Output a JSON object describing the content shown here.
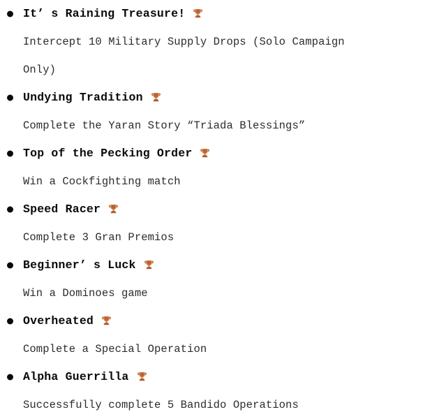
{
  "page": {
    "background_color": "#ffffff",
    "title_color": "#0a0a0a",
    "description_color": "#2c2c2c",
    "bullet_color": "#0b0b0b",
    "trophy_color": "#c87941"
  },
  "achievements": [
    {
      "name": "It’ s Raining Treasure!",
      "icon": "trophy-icon",
      "description_lines": [
        "Intercept 10 Military Supply Drops (Solo Campaign",
        "Only)"
      ]
    },
    {
      "name": "Undying Tradition",
      "icon": "trophy-icon",
      "description_lines": [
        "Complete the Yaran Story “Triada Blessings”"
      ]
    },
    {
      "name": "Top of the Pecking Order",
      "icon": "trophy-icon",
      "description_lines": [
        "Win a Cockfighting match"
      ]
    },
    {
      "name": "Speed Racer",
      "icon": "trophy-icon",
      "description_lines": [
        "Complete 3 Gran Premios"
      ]
    },
    {
      "name": "Beginner’ s Luck",
      "icon": "trophy-icon",
      "description_lines": [
        "Win a Dominoes game"
      ]
    },
    {
      "name": "Overheated",
      "icon": "trophy-icon",
      "description_lines": [
        "Complete a Special Operation"
      ]
    },
    {
      "name": "Alpha Guerrilla",
      "icon": "trophy-icon",
      "description_lines": [
        "Successfully complete 5 Bandido Operations"
      ]
    }
  ]
}
